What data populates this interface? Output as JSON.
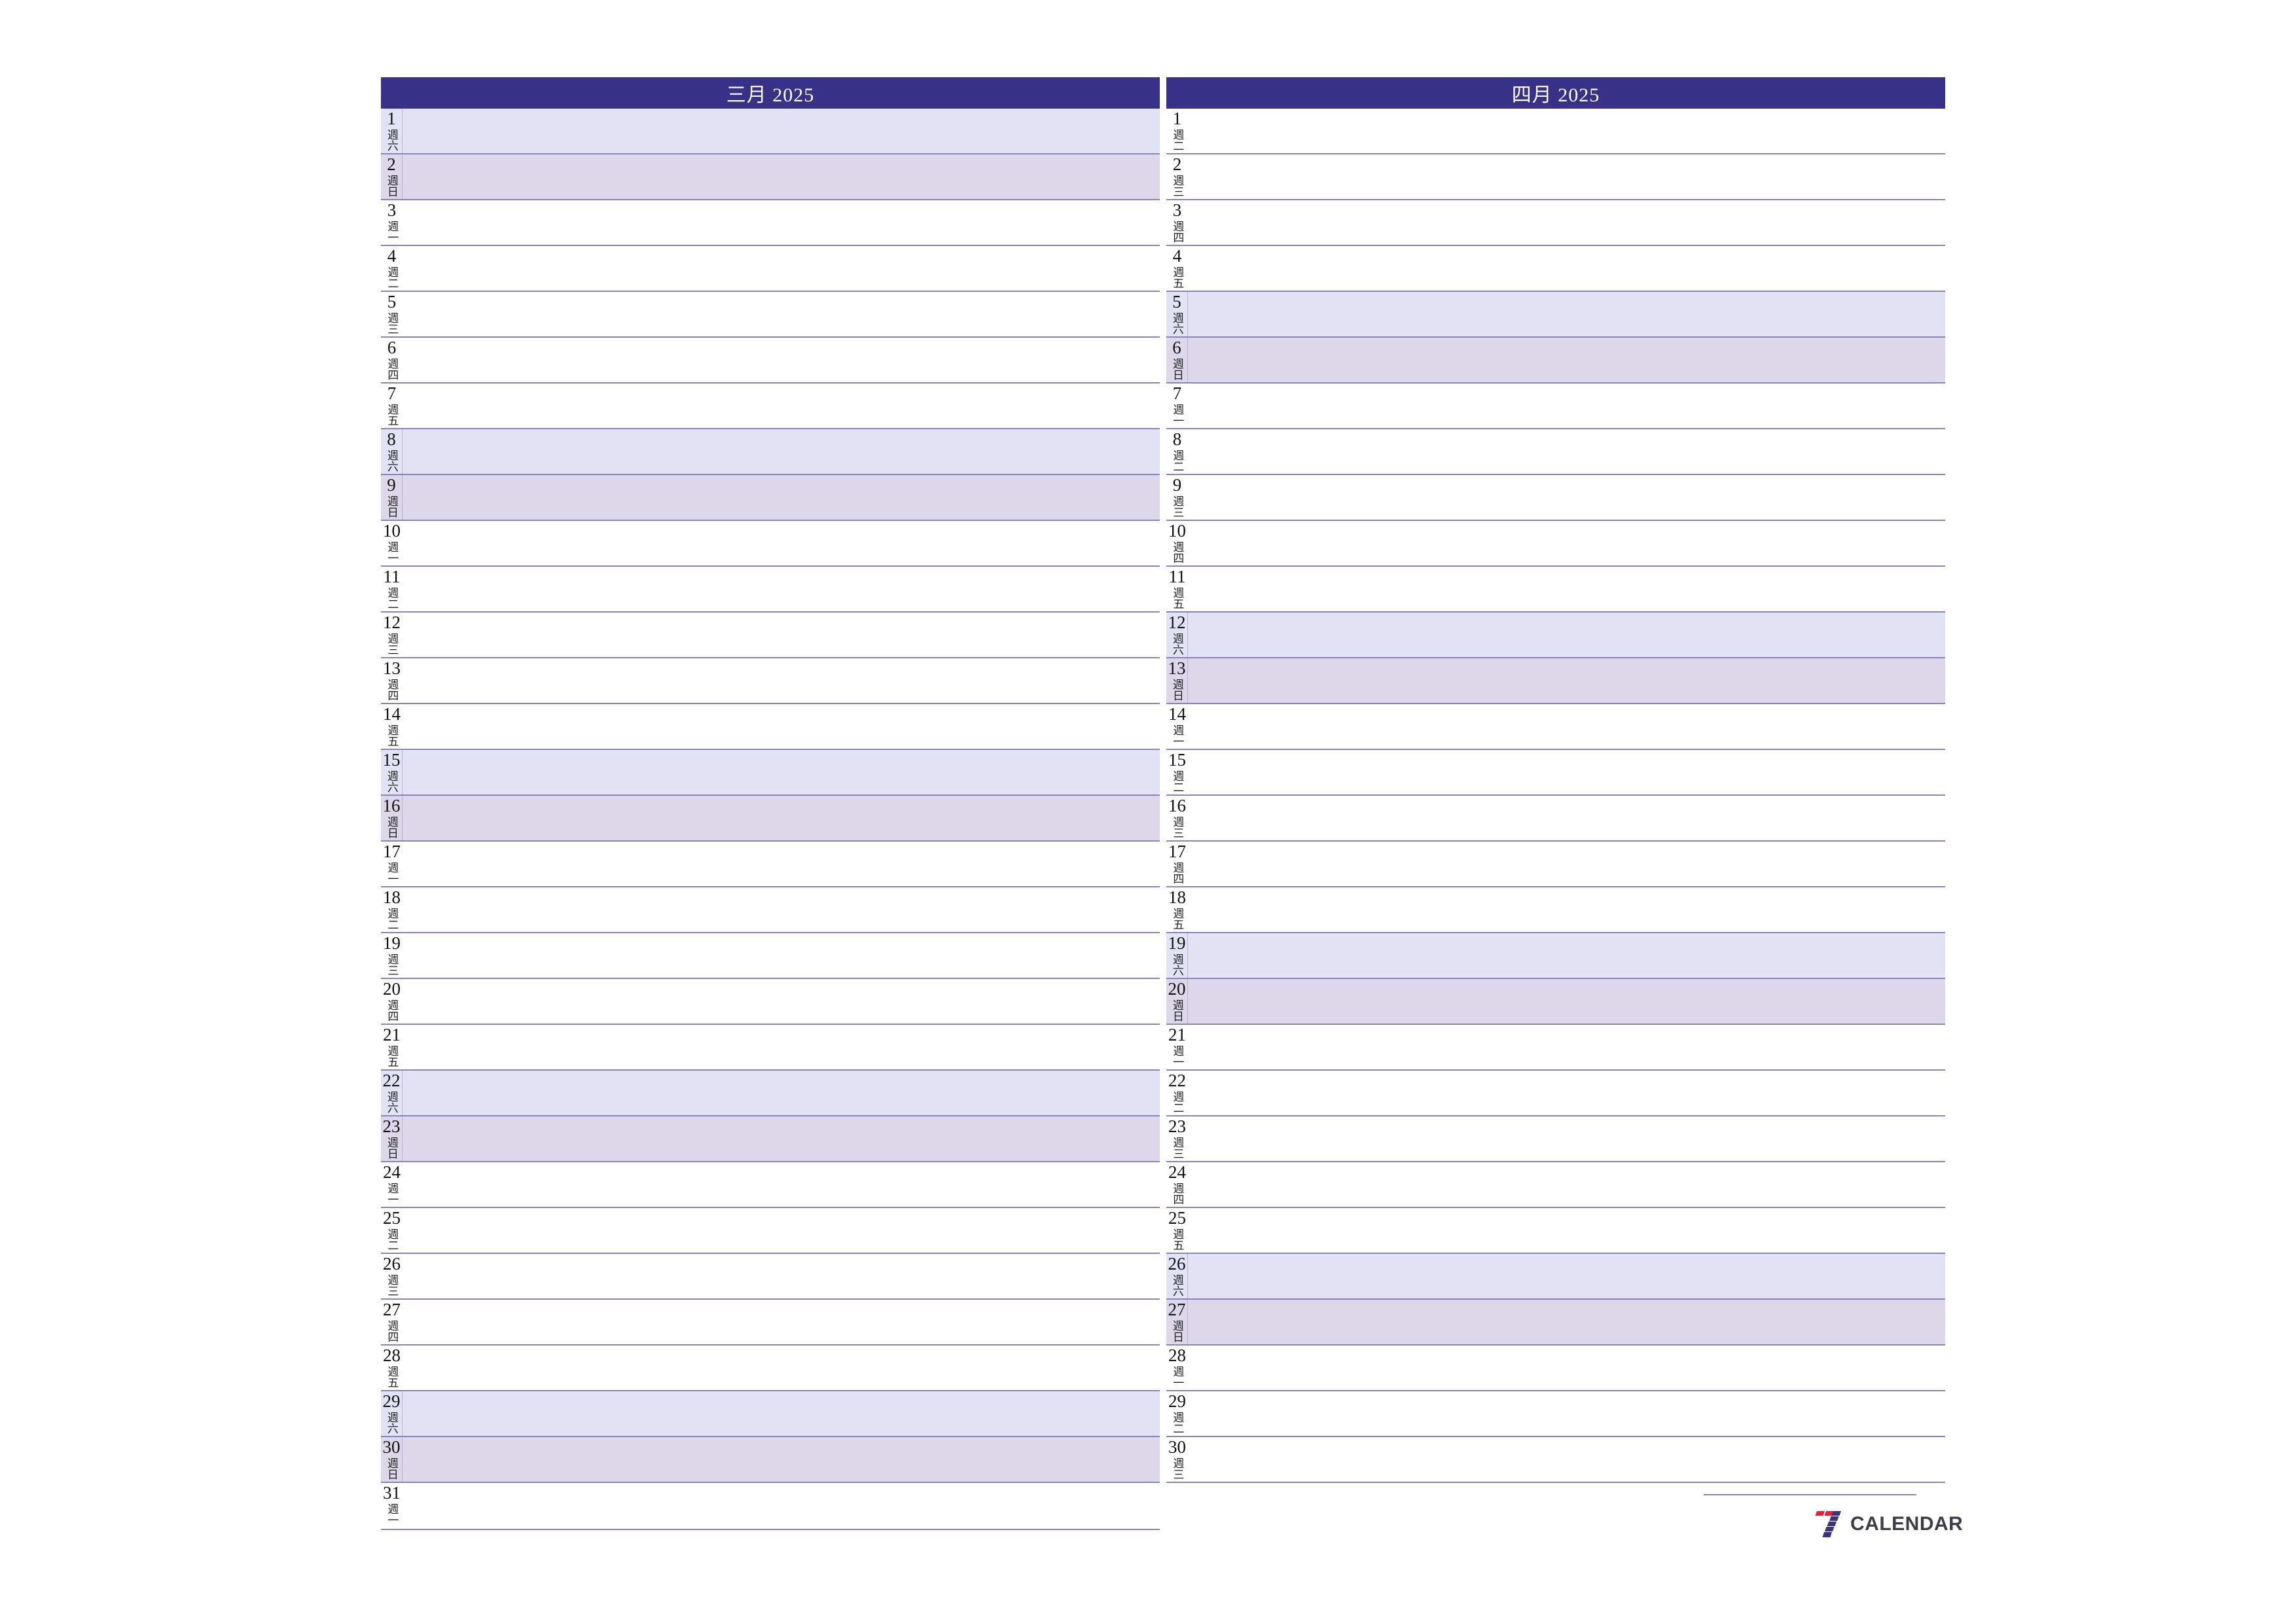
{
  "document": {
    "type": "two-month-planner",
    "year": "2025"
  },
  "colors": {
    "header_bg": "#373287",
    "header_text": "#ffffff",
    "saturday_bg": "#e3e3f6",
    "sunday_bg": "#dcd8ea",
    "rule": "#8a83bd",
    "logo_red": "#ed1b33",
    "logo_blue": "#3b3287",
    "logo_text": "#3d3d48"
  },
  "months": [
    {
      "header": "三月  2025",
      "name": "三月",
      "year": "2025",
      "days": [
        {
          "num": "1",
          "weekday": "週六",
          "kind": "sat"
        },
        {
          "num": "2",
          "weekday": "週日",
          "kind": "sun"
        },
        {
          "num": "3",
          "weekday": "週一",
          "kind": "weekday"
        },
        {
          "num": "4",
          "weekday": "週二",
          "kind": "weekday"
        },
        {
          "num": "5",
          "weekday": "週三",
          "kind": "weekday"
        },
        {
          "num": "6",
          "weekday": "週四",
          "kind": "weekday"
        },
        {
          "num": "7",
          "weekday": "週五",
          "kind": "weekday"
        },
        {
          "num": "8",
          "weekday": "週六",
          "kind": "sat"
        },
        {
          "num": "9",
          "weekday": "週日",
          "kind": "sun"
        },
        {
          "num": "10",
          "weekday": "週一",
          "kind": "weekday"
        },
        {
          "num": "11",
          "weekday": "週二",
          "kind": "weekday"
        },
        {
          "num": "12",
          "weekday": "週三",
          "kind": "weekday"
        },
        {
          "num": "13",
          "weekday": "週四",
          "kind": "weekday"
        },
        {
          "num": "14",
          "weekday": "週五",
          "kind": "weekday"
        },
        {
          "num": "15",
          "weekday": "週六",
          "kind": "sat"
        },
        {
          "num": "16",
          "weekday": "週日",
          "kind": "sun"
        },
        {
          "num": "17",
          "weekday": "週一",
          "kind": "weekday"
        },
        {
          "num": "18",
          "weekday": "週二",
          "kind": "weekday"
        },
        {
          "num": "19",
          "weekday": "週三",
          "kind": "weekday"
        },
        {
          "num": "20",
          "weekday": "週四",
          "kind": "weekday"
        },
        {
          "num": "21",
          "weekday": "週五",
          "kind": "weekday"
        },
        {
          "num": "22",
          "weekday": "週六",
          "kind": "sat"
        },
        {
          "num": "23",
          "weekday": "週日",
          "kind": "sun"
        },
        {
          "num": "24",
          "weekday": "週一",
          "kind": "weekday"
        },
        {
          "num": "25",
          "weekday": "週二",
          "kind": "weekday"
        },
        {
          "num": "26",
          "weekday": "週三",
          "kind": "weekday"
        },
        {
          "num": "27",
          "weekday": "週四",
          "kind": "weekday"
        },
        {
          "num": "28",
          "weekday": "週五",
          "kind": "weekday"
        },
        {
          "num": "29",
          "weekday": "週六",
          "kind": "sat"
        },
        {
          "num": "30",
          "weekday": "週日",
          "kind": "sun"
        },
        {
          "num": "31",
          "weekday": "週一",
          "kind": "weekday"
        }
      ]
    },
    {
      "header": "四月  2025",
      "name": "四月",
      "year": "2025",
      "days": [
        {
          "num": "1",
          "weekday": "週二",
          "kind": "weekday"
        },
        {
          "num": "2",
          "weekday": "週三",
          "kind": "weekday"
        },
        {
          "num": "3",
          "weekday": "週四",
          "kind": "weekday"
        },
        {
          "num": "4",
          "weekday": "週五",
          "kind": "weekday"
        },
        {
          "num": "5",
          "weekday": "週六",
          "kind": "sat"
        },
        {
          "num": "6",
          "weekday": "週日",
          "kind": "sun"
        },
        {
          "num": "7",
          "weekday": "週一",
          "kind": "weekday"
        },
        {
          "num": "8",
          "weekday": "週二",
          "kind": "weekday"
        },
        {
          "num": "9",
          "weekday": "週三",
          "kind": "weekday"
        },
        {
          "num": "10",
          "weekday": "週四",
          "kind": "weekday"
        },
        {
          "num": "11",
          "weekday": "週五",
          "kind": "weekday"
        },
        {
          "num": "12",
          "weekday": "週六",
          "kind": "sat"
        },
        {
          "num": "13",
          "weekday": "週日",
          "kind": "sun"
        },
        {
          "num": "14",
          "weekday": "週一",
          "kind": "weekday"
        },
        {
          "num": "15",
          "weekday": "週二",
          "kind": "weekday"
        },
        {
          "num": "16",
          "weekday": "週三",
          "kind": "weekday"
        },
        {
          "num": "17",
          "weekday": "週四",
          "kind": "weekday"
        },
        {
          "num": "18",
          "weekday": "週五",
          "kind": "weekday"
        },
        {
          "num": "19",
          "weekday": "週六",
          "kind": "sat"
        },
        {
          "num": "20",
          "weekday": "週日",
          "kind": "sun"
        },
        {
          "num": "21",
          "weekday": "週一",
          "kind": "weekday"
        },
        {
          "num": "22",
          "weekday": "週二",
          "kind": "weekday"
        },
        {
          "num": "23",
          "weekday": "週三",
          "kind": "weekday"
        },
        {
          "num": "24",
          "weekday": "週四",
          "kind": "weekday"
        },
        {
          "num": "25",
          "weekday": "週五",
          "kind": "weekday"
        },
        {
          "num": "26",
          "weekday": "週六",
          "kind": "sat"
        },
        {
          "num": "27",
          "weekday": "週日",
          "kind": "sun"
        },
        {
          "num": "28",
          "weekday": "週一",
          "kind": "weekday"
        },
        {
          "num": "29",
          "weekday": "週二",
          "kind": "weekday"
        },
        {
          "num": "30",
          "weekday": "週三",
          "kind": "weekday"
        }
      ]
    }
  ],
  "footer": {
    "logo_text": "CALENDAR",
    "logo_mark": "seven-logo-icon"
  }
}
